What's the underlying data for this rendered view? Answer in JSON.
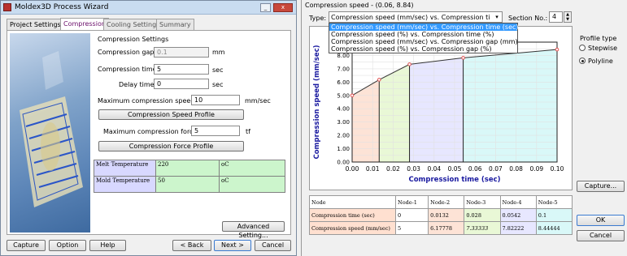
{
  "wizard": {
    "title": "Moldex3D Process Wizard",
    "tabs": [
      "Project Settings",
      "Compression",
      "Cooling Settings",
      "Summary"
    ],
    "section_title": "Compression Settings",
    "gap_label": "Compression gap :",
    "gap_value": "0.1",
    "gap_unit": "mm",
    "time_label": "Compression time :",
    "time_value": "5",
    "time_unit": "sec",
    "delay_label": "Delay time :",
    "delay_value": "0",
    "delay_unit": "sec",
    "maxspeed_label": "Maximum compression speed :",
    "maxspeed_value": "10",
    "maxspeed_unit": "mm/sec",
    "speed_profile_btn": "Compression Speed Profile",
    "maxforce_label": "Maximum compression force :",
    "maxforce_value": "5",
    "maxforce_unit": "tf",
    "force_profile_btn": "Compression Force Profile",
    "temp_rows": [
      [
        "Melt Temperature",
        "220",
        "oC"
      ],
      [
        "Mold Temperature",
        "50",
        "oC"
      ]
    ],
    "advanced_btn": "Advanced Setting...",
    "bottom_buttons": {
      "capture": "Capture",
      "option": "Option",
      "help": "Help",
      "back": "< Back",
      "next": "Next >",
      "cancel": "Cancel"
    }
  },
  "speed_window": {
    "title": "Compression speed - (0.06, 8.84)",
    "type_label": "Type:",
    "type_selected": "Compression speed (mm/sec) vs. Compression time (",
    "type_options": [
      "Compression speed (mm/sec) vs. Compression time (sec)",
      "Compression speed (%) vs. Compression time (%)",
      "Compression speed (mm/sec) vs. Compression gap (mm)",
      "Compression speed (%) vs. Compression gap (%)"
    ],
    "section_label": "Section No.:",
    "section_value": "4",
    "profile_type_label": "Profile type",
    "profile_options": [
      "Stepwise",
      "Polyline"
    ],
    "profile_selected": "Polyline",
    "capture_btn": "Capture...",
    "ok_btn": "OK",
    "cancel_btn": "Cancel",
    "node_table": {
      "header": [
        "Node",
        "Node-1",
        "Node-2",
        "Node-3",
        "Node-4",
        "Node-5"
      ],
      "rows": [
        [
          "Compression time (sec)",
          "0",
          "0.0132",
          "0.028",
          "0.0542",
          "0.1"
        ],
        [
          "Compression speed (mm/sec)",
          "5",
          "6.17778",
          "7.33333",
          "7.82222",
          "8.44444"
        ]
      ]
    }
  },
  "chart_data": {
    "type": "line",
    "xlabel": "Compression time (sec)",
    "ylabel": "Compression speed (mm/sec)",
    "xlim": [
      0,
      0.1
    ],
    "ylim": [
      0,
      9
    ],
    "xticks": [
      "0.00",
      "0.01",
      "0.02",
      "0.03",
      "0.04",
      "0.05",
      "0.06",
      "0.07",
      "0.08",
      "0.09",
      "0.10"
    ],
    "yticks": [
      "0.00",
      "0.50",
      "1.00",
      "1.50",
      "2.00",
      "2.50",
      "3.00",
      "3.50",
      "4.00",
      "4.50",
      "5.00",
      "5.50",
      "6.00",
      "6.50",
      "7.00",
      "7.50",
      "8.00",
      "8.50",
      "9.00"
    ],
    "x": [
      0,
      0.0132,
      0.028,
      0.0542,
      0.1
    ],
    "y": [
      5,
      6.17778,
      7.33333,
      7.82222,
      8.44444
    ],
    "section_colors": [
      "#fde3d6",
      "#e9f8d6",
      "#e7e7ff",
      "#d9f8f8"
    ],
    "line_color": "#333333",
    "point_color": "#e05050"
  }
}
